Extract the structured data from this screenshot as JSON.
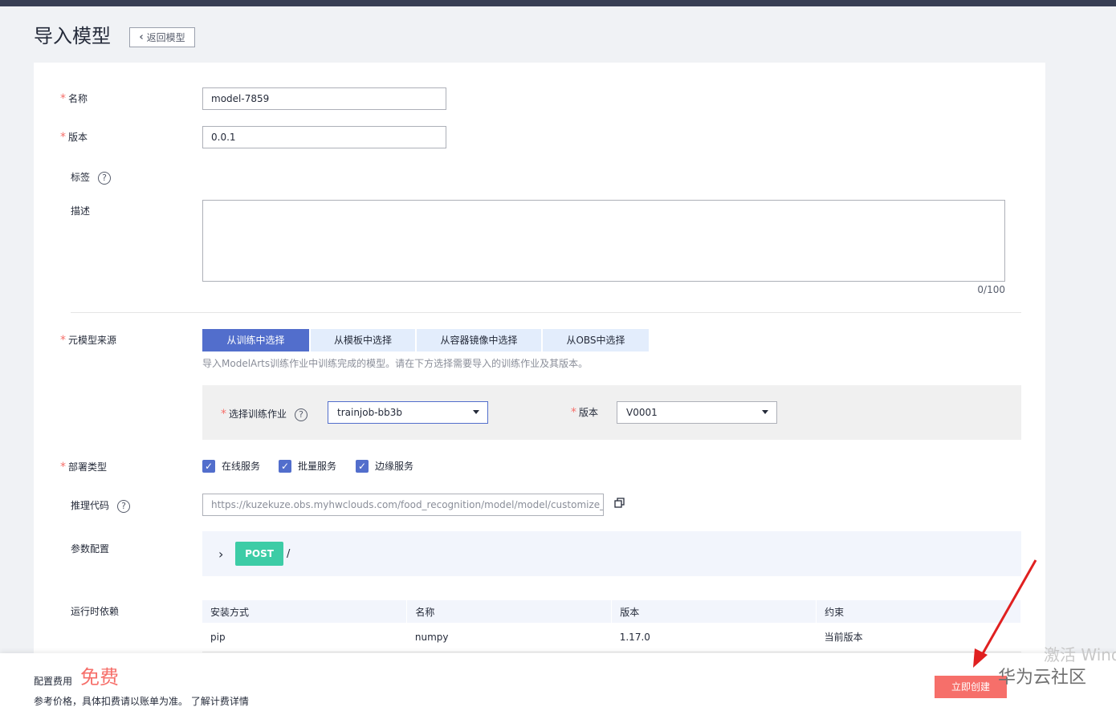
{
  "page": {
    "title": "导入模型",
    "back_label": "返回模型"
  },
  "form": {
    "name_label": "名称",
    "name_value": "model-7859",
    "version_label": "版本",
    "version_value": "0.0.1",
    "tags_label": "标签",
    "desc_label": "描述",
    "desc_counter": "0/100",
    "source_label": "元模型来源",
    "source_tabs": [
      "从训练中选择",
      "从模板中选择",
      "从容器镜像中选择",
      "从OBS中选择"
    ],
    "source_hint": "导入ModelArts训练作业中训练完成的模型。请在下方选择需要导入的训练作业及其版本。",
    "train_job_label": "选择训练作业",
    "train_job_value": "trainjob-bb3b",
    "train_version_label": "版本",
    "train_version_value": "V0001",
    "deploy_label": "部署类型",
    "deploy_options": [
      "在线服务",
      "批量服务",
      "边缘服务"
    ],
    "infer_code_label": "推理代码",
    "infer_code_value": "https://kuzekuze.obs.myhwclouds.com/food_recognition/model/model/customize_",
    "params_label": "参数配置",
    "post_method": "POST",
    "post_path": "/",
    "runtime_label": "运行时依赖",
    "dep_headers": [
      "安装方式",
      "名称",
      "版本",
      "约束"
    ],
    "dep_rows": [
      [
        "pip",
        "numpy",
        "1.17.0",
        "当前版本"
      ]
    ]
  },
  "footer": {
    "fee_label": "配置费用",
    "fee_value": "免费",
    "fee_note": "参考价格，具体扣费请以账单为准。 了解计费详情",
    "create_label": "立即创建"
  },
  "overlay": {
    "watermark_text": "激活 Wind",
    "site_watermark": "华为云社区"
  },
  "colors": {
    "accent": "#526ecc",
    "danger": "#f66f6a",
    "post": "#3dcca6"
  }
}
